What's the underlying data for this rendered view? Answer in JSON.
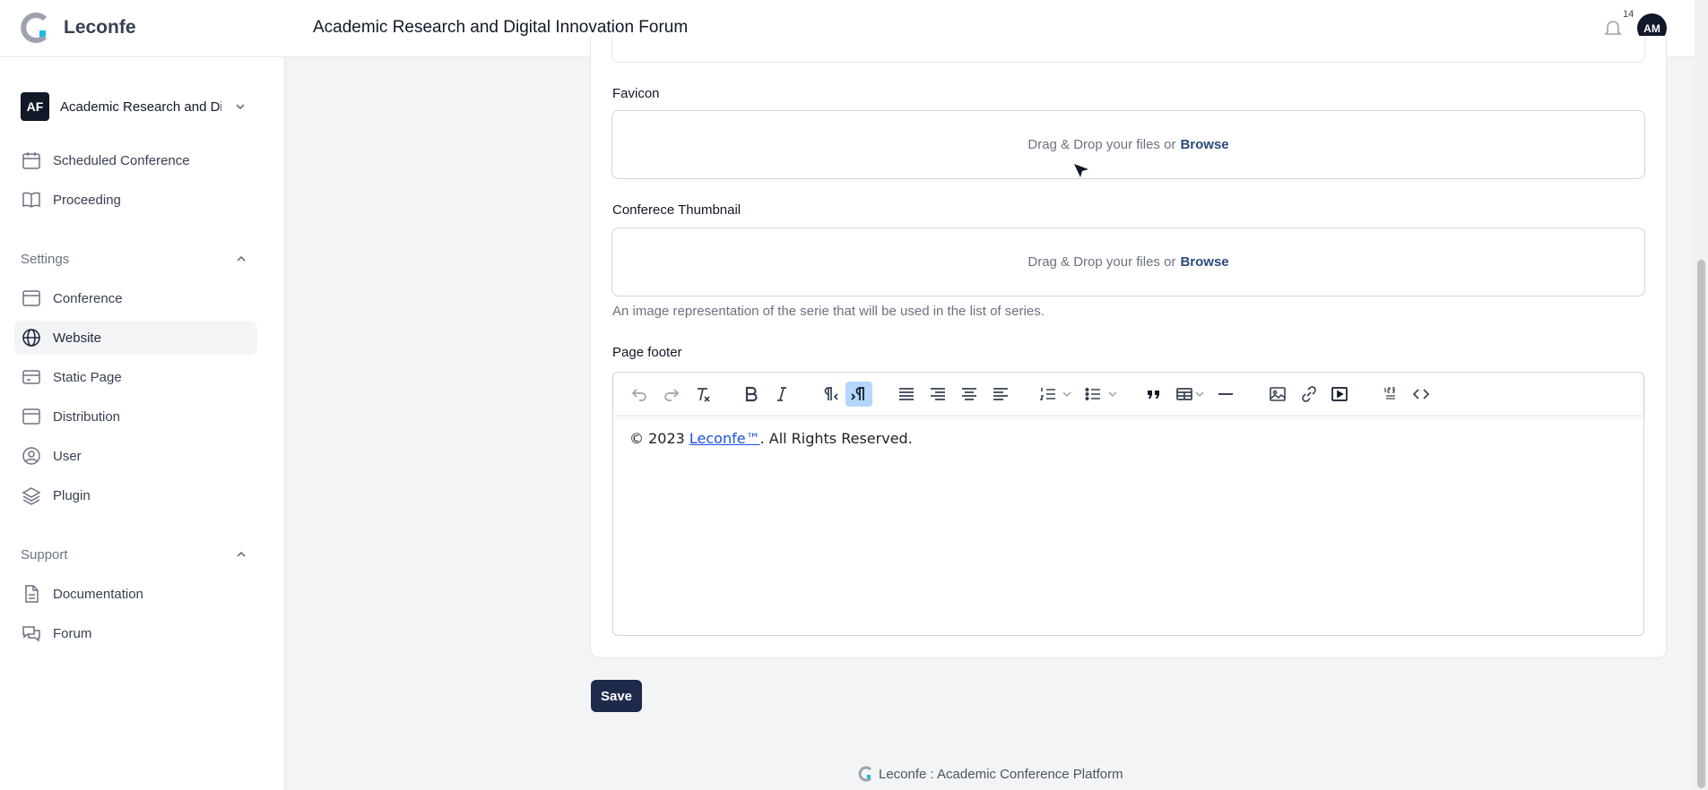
{
  "header": {
    "logo_text": "Leconfe",
    "forum_title": "Academic Research and Digital Innovation Forum",
    "notification_count": "14",
    "avatar_initials": "AM"
  },
  "sidebar": {
    "switcher": {
      "badge": "AF",
      "label": "Academic Research and Digital Innovation Forum"
    },
    "items": [
      {
        "label": "Scheduled Conference",
        "icon": "calendar-icon"
      },
      {
        "label": "Proceeding",
        "icon": "book-open-icon"
      }
    ],
    "settings": {
      "label": "Settings",
      "items": [
        {
          "label": "Conference",
          "icon": "window-icon"
        },
        {
          "label": "Website",
          "icon": "globe-icon",
          "active": true
        },
        {
          "label": "Static Page",
          "icon": "card-icon"
        },
        {
          "label": "Distribution",
          "icon": "window-icon"
        },
        {
          "label": "User",
          "icon": "user-circle-icon"
        },
        {
          "label": "Plugin",
          "icon": "stack-icon"
        }
      ]
    },
    "support": {
      "label": "Support",
      "items": [
        {
          "label": "Documentation",
          "icon": "document-icon"
        },
        {
          "label": "Forum",
          "icon": "chat-bubbles-icon"
        }
      ]
    }
  },
  "form": {
    "favicon": {
      "label": "Favicon",
      "drop_text": "Drag & Drop your files or",
      "browse": "Browse"
    },
    "thumbnail": {
      "label": "Conferece Thumbnail",
      "drop_text": "Drag & Drop your files or",
      "browse": "Browse",
      "hint": "An image representation of the serie that will be used in the list of series."
    },
    "page_footer": {
      "label": "Page footer",
      "content_prefix": "© 2023 ",
      "content_link": "Leconfe™",
      "content_suffix": ". All Rights Reserved.",
      "toolbar": [
        "undo-icon",
        "redo-icon",
        "clear-formatting-icon",
        "bold-icon",
        "italic-icon",
        "ltr-icon",
        "rtl-icon",
        "align-justify-icon",
        "align-right-icon",
        "align-center-icon",
        "align-left-icon",
        "numbered-list-icon",
        "bullet-list-icon",
        "blockquote-icon",
        "table-icon",
        "horizontal-rule-icon",
        "image-icon",
        "link-icon",
        "media-icon",
        "spellcheck-icon",
        "source-code-icon"
      ]
    },
    "save_label": "Save"
  },
  "footer": {
    "text": "Leconfe : Academic Conference Platform"
  },
  "colors": {
    "primary": "#1e2a4a",
    "browse_link": "#2b4a7c",
    "active_toolbar": "#b4d7ff"
  }
}
